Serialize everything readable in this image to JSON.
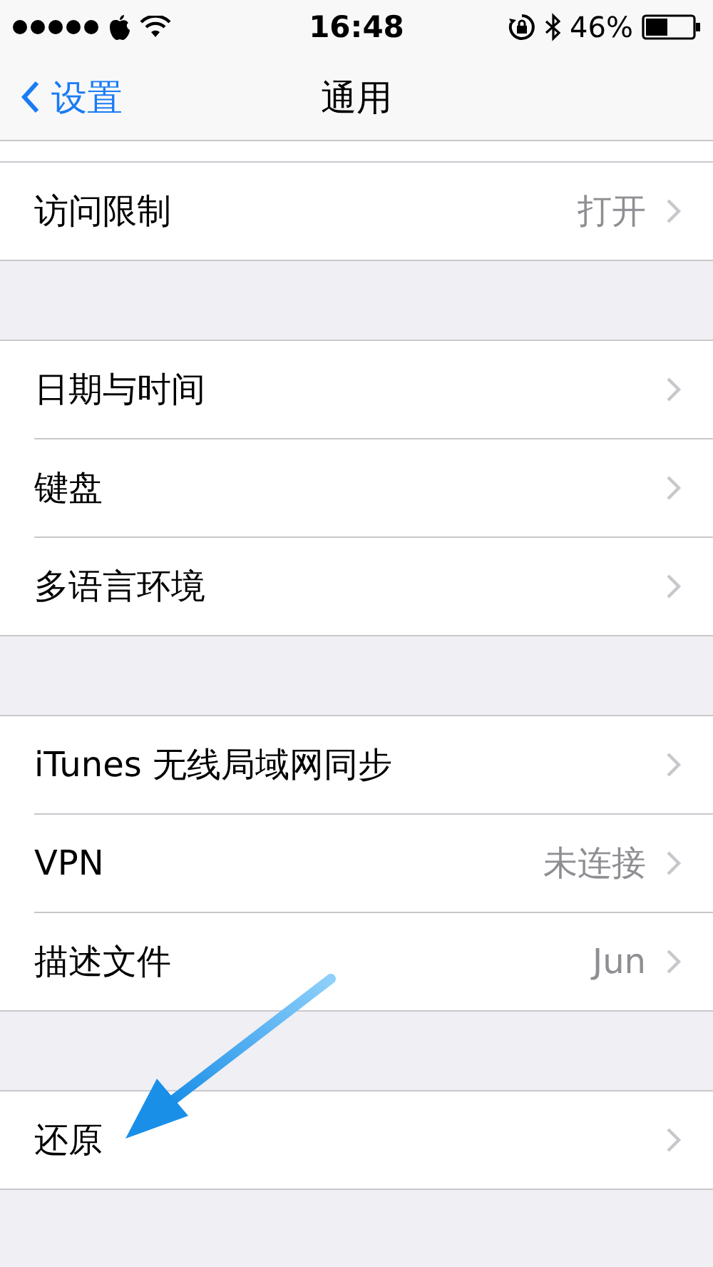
{
  "status_bar": {
    "time": "16:48",
    "battery": "46%"
  },
  "nav": {
    "back": "设置",
    "title": "通用"
  },
  "sections": [
    {
      "rows": [
        {
          "label": "访问限制",
          "value": "打开"
        }
      ]
    },
    {
      "rows": [
        {
          "label": "日期与时间"
        },
        {
          "label": "键盘"
        },
        {
          "label": "多语言环境"
        }
      ]
    },
    {
      "rows": [
        {
          "label": "iTunes 无线局域网同步"
        },
        {
          "label": "VPN",
          "value": "未连接"
        },
        {
          "label": "描述文件",
          "value": "Jun"
        }
      ]
    },
    {
      "rows": [
        {
          "label": "还原"
        }
      ]
    }
  ]
}
